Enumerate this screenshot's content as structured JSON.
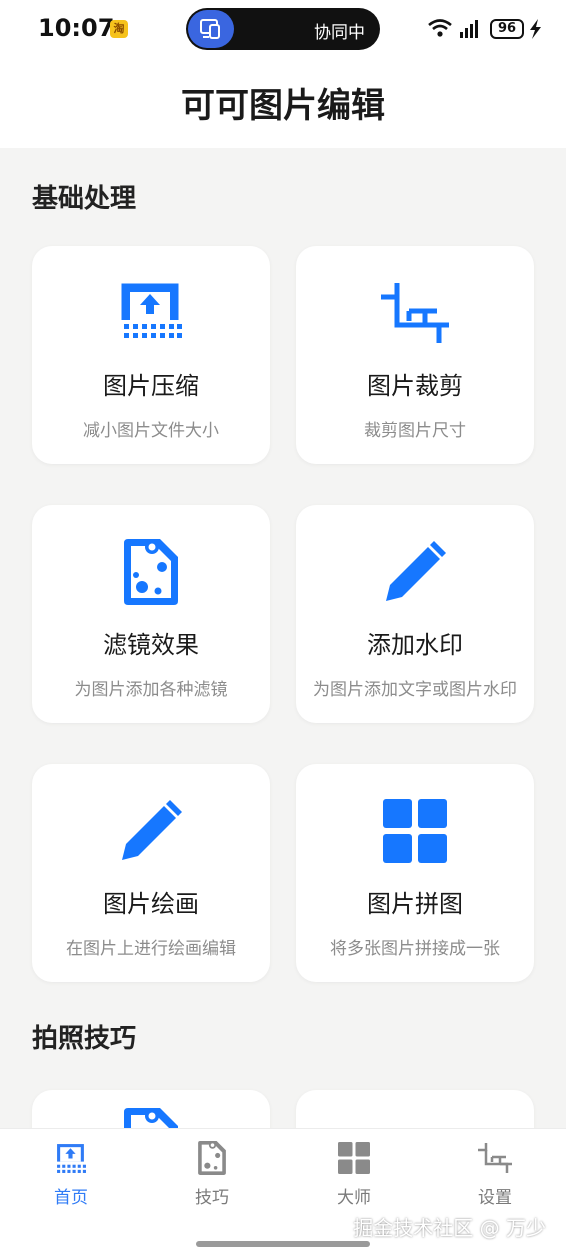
{
  "status_bar": {
    "time": "10:07",
    "app_badge": "淘",
    "island_text": "协同中",
    "battery": "96"
  },
  "header": {
    "title": "可可图片编辑"
  },
  "sections": [
    {
      "title": "基础处理"
    },
    {
      "title": "拍照技巧"
    }
  ],
  "cards": [
    {
      "title": "图片压缩",
      "desc": "减小图片文件大小",
      "icon": "compress-icon"
    },
    {
      "title": "图片裁剪",
      "desc": "裁剪图片尺寸",
      "icon": "crop-icon"
    },
    {
      "title": "滤镜效果",
      "desc": "为图片添加各种滤镜",
      "icon": "filter-icon"
    },
    {
      "title": "添加水印",
      "desc": "为图片添加文字或图片水印",
      "icon": "pencil-icon"
    },
    {
      "title": "图片绘画",
      "desc": "在图片上进行绘画编辑",
      "icon": "pencil-icon"
    },
    {
      "title": "图片拼图",
      "desc": "将多张图片拼接成一张",
      "icon": "grid-icon"
    }
  ],
  "bottom_nav": [
    {
      "label": "首页",
      "icon": "home-compress-icon",
      "active": true
    },
    {
      "label": "技巧",
      "icon": "tips-icon",
      "active": false
    },
    {
      "label": "大师",
      "icon": "grid-icon",
      "active": false
    },
    {
      "label": "设置",
      "icon": "crop-icon",
      "active": false
    }
  ],
  "watermark": "掘金技术社区 @ 万少",
  "colors": {
    "accent": "#1677ff",
    "nav_active": "#2f7bf6",
    "nav_inactive": "#7a7a7a"
  }
}
